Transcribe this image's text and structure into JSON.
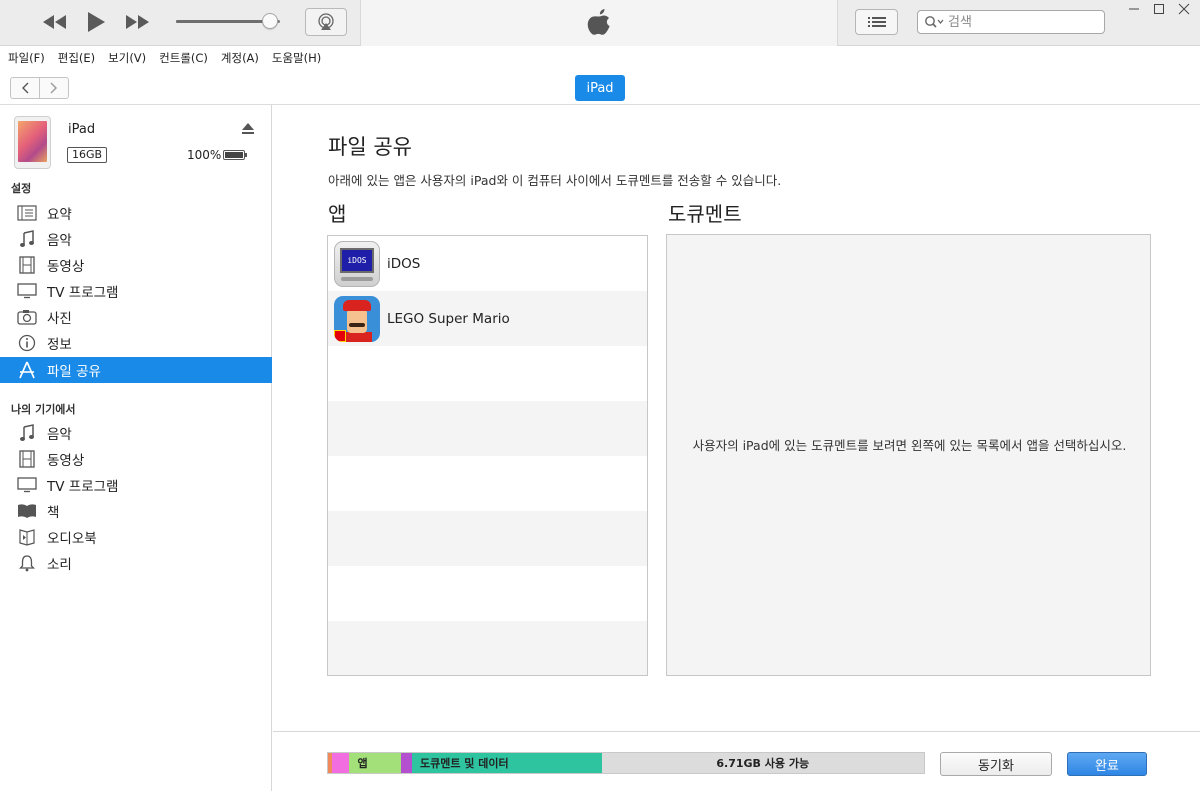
{
  "search": {
    "placeholder": "검색"
  },
  "menu": [
    "파일(F)",
    "편집(E)",
    "보기(V)",
    "컨트롤(C)",
    "계정(A)",
    "도움말(H)"
  ],
  "nav": {
    "device_button": "iPad"
  },
  "device": {
    "name": "iPad",
    "capacity": "16GB",
    "battery": "100%",
    "battery_level": 1.0
  },
  "volume": {
    "level": 0.9
  },
  "sidebar": {
    "settings_title": "설정",
    "settings_items": [
      {
        "label": "요약",
        "icon": "summary-icon"
      },
      {
        "label": "음악",
        "icon": "music-note-icon"
      },
      {
        "label": "동영상",
        "icon": "film-icon"
      },
      {
        "label": "TV 프로그램",
        "icon": "tv-icon"
      },
      {
        "label": "사진",
        "icon": "camera-icon"
      },
      {
        "label": "정보",
        "icon": "info-icon"
      },
      {
        "label": "파일 공유",
        "icon": "file-sharing-icon",
        "selected": true
      }
    ],
    "on_device_title": "나의 기기에서",
    "on_device_items": [
      {
        "label": "음악",
        "icon": "music-note-icon"
      },
      {
        "label": "동영상",
        "icon": "film-icon"
      },
      {
        "label": "TV 프로그램",
        "icon": "tv-icon"
      },
      {
        "label": "책",
        "icon": "book-icon"
      },
      {
        "label": "오디오북",
        "icon": "audiobook-icon"
      },
      {
        "label": "소리",
        "icon": "bell-icon"
      }
    ]
  },
  "main": {
    "title": "파일 공유",
    "description": "아래에 있는 앱은 사용자의 iPad와 이 컴퓨터 사이에서 도큐멘트를 전송할 수 있습니다.",
    "apps_header": "앱",
    "docs_header": "도큐멘트",
    "apps": [
      {
        "name": "iDOS",
        "icon": "idos-app-icon",
        "screen_text": "iDOS"
      },
      {
        "name": "LEGO Super Mario",
        "icon": "lego-super-mario-app-icon"
      }
    ],
    "docs_hint": "사용자의 iPad에 있는 도큐멘트를 보려면 왼쪽에 있는 목록에서 앱을 선택하십시오."
  },
  "footer": {
    "storage_segments": [
      {
        "label": "",
        "fraction": 0.006,
        "color": "#f08a5d"
      },
      {
        "label": "",
        "fraction": 0.03,
        "color": "#f26ee0"
      },
      {
        "label": "앱",
        "fraction": 0.087,
        "color": "#a3e07a"
      },
      {
        "label": "",
        "fraction": 0.018,
        "color": "#b44fd0"
      },
      {
        "label": "도큐멘트 및 데이터",
        "fraction": 0.318,
        "color": "#2ec4a0"
      },
      {
        "label": "6.71GB 사용 가능",
        "fraction": 0.541,
        "color": "#dcdcdc"
      }
    ],
    "sync_label": "동기화",
    "done_label": "완료"
  }
}
